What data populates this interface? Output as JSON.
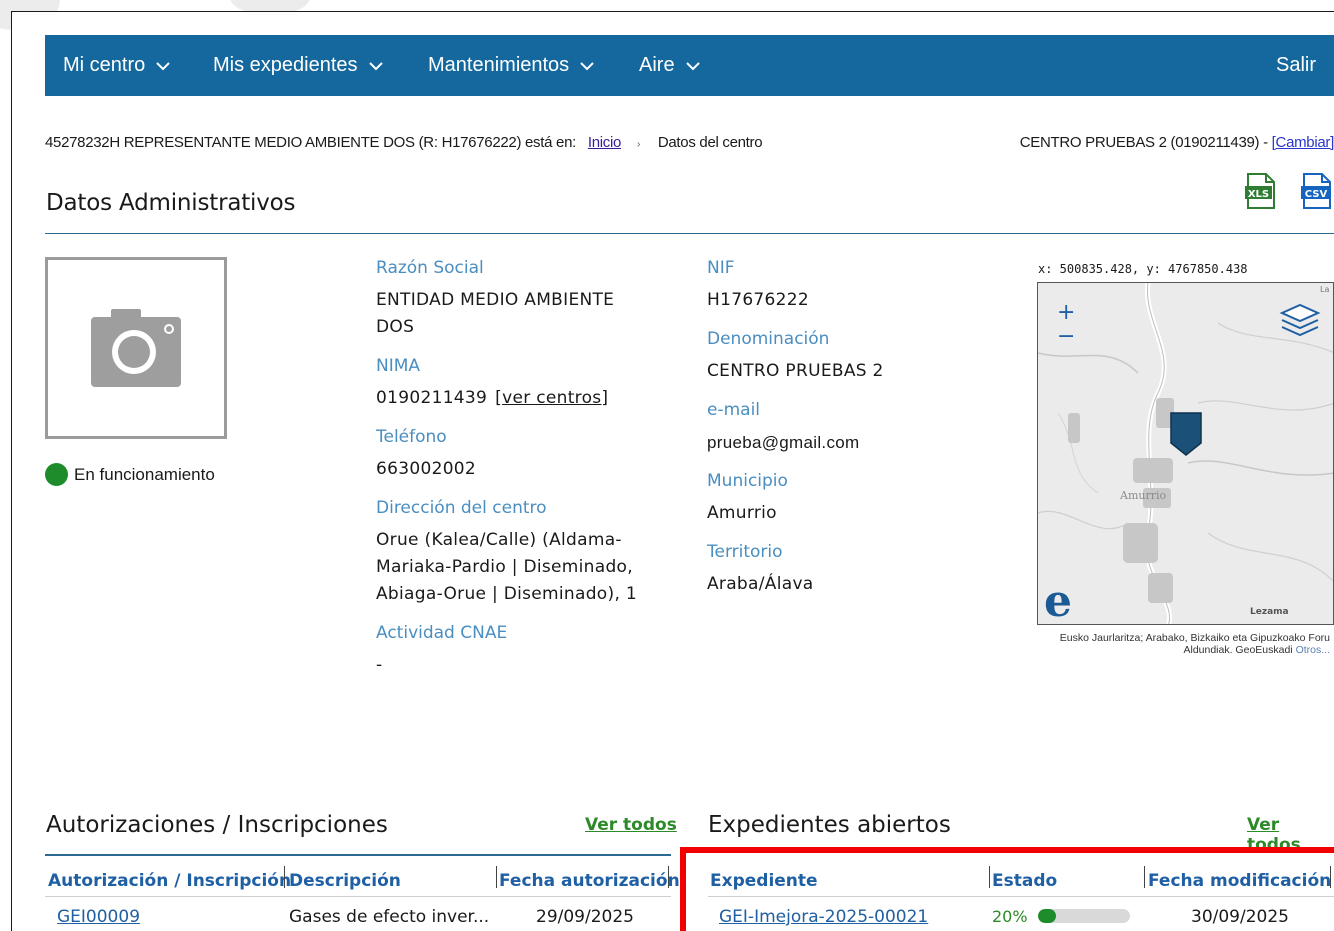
{
  "navbar": {
    "items": [
      {
        "label": "Mi centro"
      },
      {
        "label": "Mis expedientes"
      },
      {
        "label": "Mantenimientos"
      },
      {
        "label": "Aire"
      }
    ],
    "logout": "Salir"
  },
  "breadcrumb": {
    "user_text": "45278232H REPRESENTANTE MEDIO AMBIENTE DOS (R: H17676222) está en:",
    "home": "Inicio",
    "current": "Datos del centro"
  },
  "center": {
    "text": "CENTRO PRUEBAS 2 (0190211439) -",
    "change_link": "[Cambiar]"
  },
  "section": {
    "title": "Datos Administrativos",
    "export_xls": "XLS",
    "export_csv": "CSV"
  },
  "status": {
    "label": "En funcionamiento",
    "color": "#1f8c2c"
  },
  "admin": {
    "razon_social_label": "Razón Social",
    "razon_social": "ENTIDAD MEDIO AMBIENTE DOS",
    "nima_label": "NIMA",
    "nima": "0190211439",
    "ver_centros": "[ver centros]",
    "telefono_label": "Teléfono",
    "telefono": "663002002",
    "direccion_label": "Dirección del centro",
    "direccion": "Orue (Kalea/Calle) (Aldama-Mariaka-Pardio | Diseminado, Abiaga-Orue | Diseminado), 1",
    "cnae_label": "Actividad CNAE",
    "cnae": "-",
    "nif_label": "NIF",
    "nif": "H17676222",
    "denominacion_label": "Denominación",
    "denominacion": "CENTRO PRUEBAS 2",
    "email_label": "e-mail",
    "email": "prueba@gmail.com",
    "municipio_label": "Municipio",
    "municipio": "Amurrio",
    "territorio_label": "Territorio",
    "territorio": "Araba/Álava"
  },
  "map": {
    "coords": "x: 500835.428, y: 4767850.438",
    "zoom_in": "+",
    "zoom_out": "−",
    "place_label_1": "Amurrio",
    "place_label_2": "Lezama",
    "corner_label": "La",
    "attribution": "Eusko Jaurlaritza; Arabako, Bizkaiko eta Gipuzkoako Foru Aldundiak. GeoEuskadi",
    "attribution_link": "Otros..."
  },
  "autorizaciones": {
    "title": "Autorizaciones / Inscripciones",
    "ver_todos": "Ver todos",
    "columns": [
      "Autorización / Inscripción",
      "Descripción",
      "Fecha autorización"
    ],
    "rows": [
      {
        "id": "GEI00009",
        "descripcion": "Gases de efecto inver...",
        "fecha": "29/09/2025"
      }
    ]
  },
  "expedientes": {
    "title": "Expedientes abiertos",
    "ver_todos": "Ver todos",
    "columns": [
      "Expediente",
      "Estado",
      "Fecha modificación"
    ],
    "rows": [
      {
        "id": "GEI-Imejora-2025-00021",
        "estado": "20%",
        "progress": 0.2,
        "fecha": "30/09/2025"
      }
    ]
  }
}
